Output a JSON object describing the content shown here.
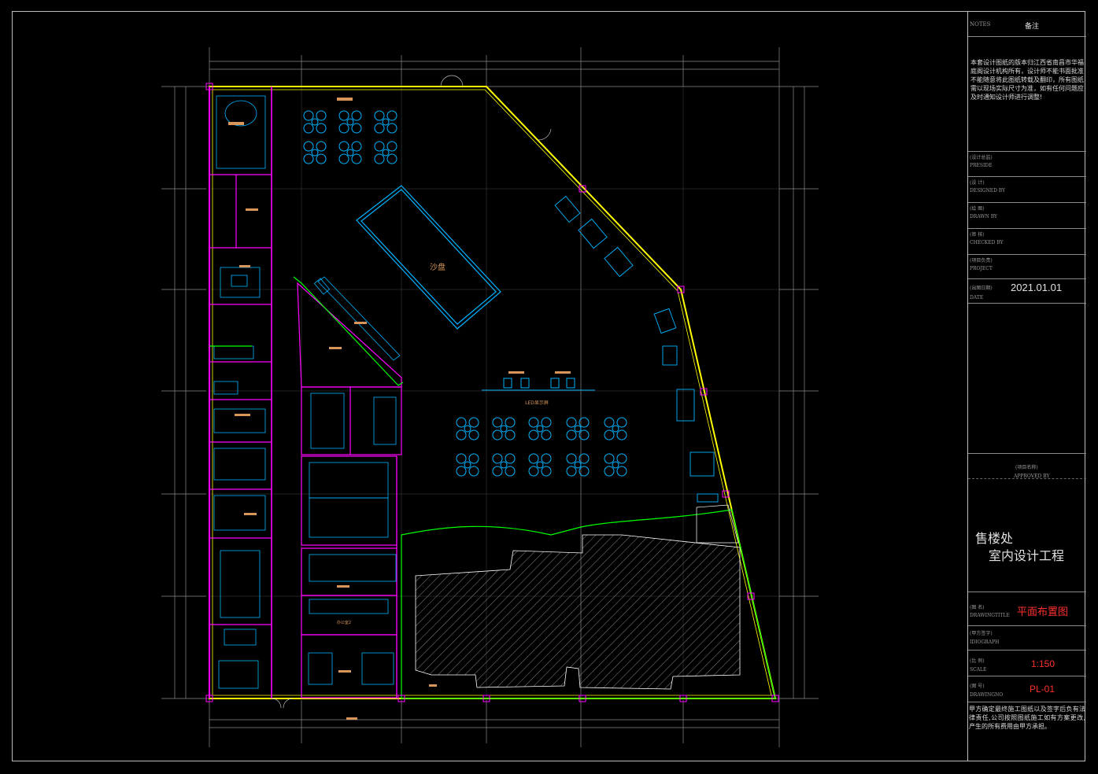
{
  "drawing": {
    "room_labels": {
      "sandtable": "沙盘",
      "led": "LED显示屏",
      "office2": "办公室2"
    },
    "colors": {
      "wall": "#ff00ff",
      "window": "#ffff00",
      "furniture": "#00b4ff",
      "green": "#00ff00",
      "dim": "#a0a0a0",
      "tag": "#d8965a"
    }
  },
  "title_block": {
    "notes_label": "NOTES",
    "notes_cn": "备注",
    "notes_text": "本套设计图纸的版本归江西省南昌市华福庭阁设计机构所有，设计师不能书面批准不能随意将此图纸转载及翻印，所有图纸需以现场实际尺寸为准，如有任何问题应及时通知设计师进行调整!",
    "preside_cn": "(设计总监)",
    "preside_en": "PRESIDE",
    "designed_cn": "(设    计)",
    "designed_en": "DESIGNED BY",
    "drawn_cn": "(绘    图)",
    "drawn_en": "DRAWN BY",
    "checked_cn": "(审    核)",
    "checked_en": "CHECKED BY",
    "project_cn": "(项目负责)",
    "project_en": "PROJECT",
    "date_cn": "(出图日期)",
    "date_en": "DATE",
    "date_value": "2021.01.01",
    "projname_cn": "(项目名称)",
    "projname_en": "APPROVED BY",
    "project_name_1": "售楼处",
    "project_name_2": "室内设计工程",
    "title_cn": "(图    名)",
    "title_en": "DRAWINGTITLE",
    "title_value": "平面布置图",
    "sign_cn": "(甲方签字)",
    "sign_en": "IDIOGRAPH",
    "scale_cn": "(比    例)",
    "scale_en": "SCALE",
    "scale_value": "1:150",
    "drawno_cn": "(图    号)",
    "drawno_en": "DRAWINGNO",
    "drawno_value": "PL-01",
    "footer_text": "甲方确定最终施工图纸以及签字后负有法律责任,公司按照图纸施工如有方案更改,产生的所有费用由甲方承担。"
  }
}
